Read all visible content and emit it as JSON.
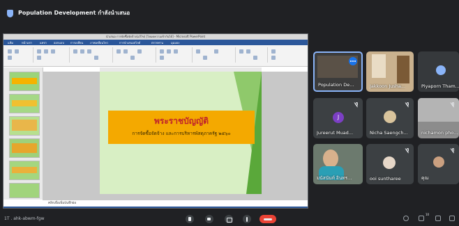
{
  "meeting": {
    "title": "Population Development กำลังนำเสนอ",
    "meeting_code": "1T . ahk-abwm-fgw",
    "participant_count": "10"
  },
  "powerpoint": {
    "window_title": "นำเสนอ การจัดซื้อจัดจ้าง(แก้ไข) [โหมดความเข้ากันได้] - Microsoft PowerPoint",
    "tabs": [
      "แฟ้ม",
      "หน้าแรก",
      "แทรก",
      "ออกแบบ",
      "การเปลี่ยน",
      "ภาพเคลื่อนไหว",
      "การนำเสนอสไลด์",
      "ตรวจทาน",
      "มุมมอง"
    ],
    "slide_title": "พระราชบัญญัติ",
    "slide_subtitle": "การจัดซื้อจัดจ้าง และการบริหารพัสดุภาครัฐ ๒๕๖๐",
    "notes_placeholder": "คลิกเพื่อเพิ่มบันทึกย่อ"
  },
  "participants": [
    {
      "name": "Population De...",
      "status": "presenting"
    },
    {
      "name": "Jakkoon Jusha...",
      "status": "video"
    },
    {
      "name": "Piyaporn Tham...",
      "status": "avatar"
    },
    {
      "name": "Jureerut Muad...",
      "status": "muted",
      "initial": "J"
    },
    {
      "name": "Nicha Saengch...",
      "status": "muted"
    },
    {
      "name": "nichamon pho...",
      "status": "video"
    },
    {
      "name": "มนัสนันท์ อินทร...",
      "status": "video"
    },
    {
      "name": "ooi suntharee",
      "status": "muted"
    },
    {
      "name": "คุณ",
      "status": "muted"
    }
  ],
  "colors": {
    "accent": "#1a73e8",
    "end_call": "#ea4335",
    "ppt_blue": "#2b579a",
    "slide_banner": "#f4a900",
    "slide_title_text": "#c0242a"
  },
  "icons": [
    "shield-icon",
    "mic-icon",
    "camera-icon",
    "present-icon",
    "more-icon",
    "end-call-icon",
    "info-icon",
    "people-icon",
    "chat-icon",
    "activities-icon",
    "mic-off-icon",
    "more-options-icon"
  ]
}
